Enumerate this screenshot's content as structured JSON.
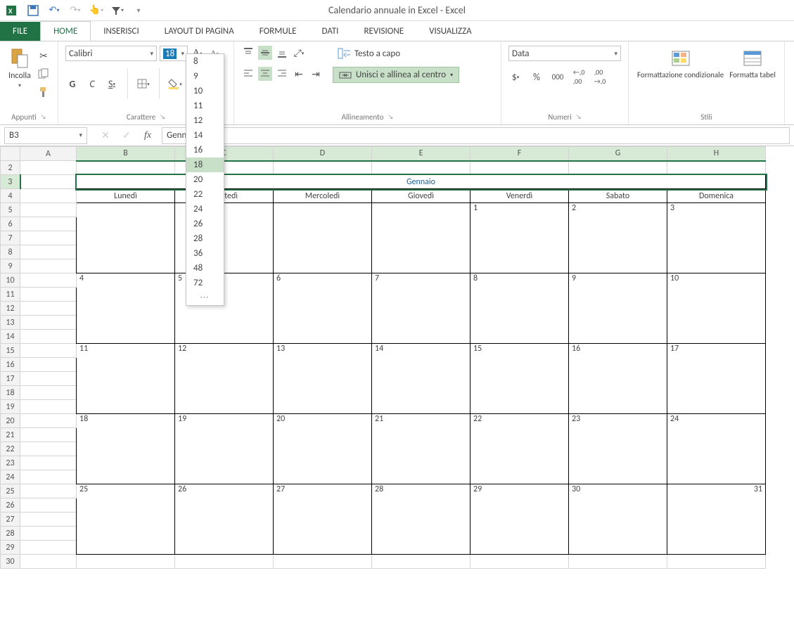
{
  "window_title": "Calendario annuale in Excel - Excel",
  "qat": {
    "undo_hint": "Undo",
    "redo_hint": "Redo"
  },
  "tabs": {
    "file": "FILE",
    "home": "HOME",
    "insert": "INSERISCI",
    "layout": "LAYOUT DI PAGINA",
    "formulas": "FORMULE",
    "data": "DATI",
    "review": "REVISIONE",
    "view": "VISUALIZZA"
  },
  "ribbon": {
    "clipboard": {
      "paste": "Incolla",
      "label": "Appunti"
    },
    "font": {
      "name": "Calibri",
      "size": "18",
      "label": "Carattere",
      "bold": "G",
      "italic": "C",
      "underline": "S",
      "sizes": [
        "8",
        "9",
        "10",
        "11",
        "12",
        "14",
        "16",
        "18",
        "20",
        "22",
        "24",
        "26",
        "28",
        "36",
        "48",
        "72"
      ]
    },
    "alignment": {
      "wrap": "Testo a capo",
      "merge": "Unisci e allinea al centro",
      "label": "Allineamento"
    },
    "number": {
      "format": "Data",
      "label": "Numeri"
    },
    "styles": {
      "condfmt": "Formattazione condizionale",
      "tablefmt": "Formatta tabel",
      "label": "Stili"
    }
  },
  "formula_bar": {
    "cell_ref": "B3",
    "formula": "Gennaio"
  },
  "columns": [
    "A",
    "B",
    "C",
    "D",
    "E",
    "F",
    "G",
    "H"
  ],
  "row_headers": [
    "2",
    "3",
    "4",
    "5",
    "6",
    "7",
    "8",
    "9",
    "10",
    "11",
    "12",
    "13",
    "14",
    "15",
    "16",
    "17",
    "18",
    "19",
    "20",
    "21",
    "22",
    "23",
    "24",
    "25",
    "26",
    "27",
    "28",
    "29",
    "30"
  ],
  "calendar": {
    "month": "Gennaio",
    "days": [
      "Lunedì",
      "Martedì",
      "Mercoledì",
      "Giovedì",
      "Venerdì",
      "Sabato",
      "Domenica"
    ],
    "weeks": [
      [
        "",
        "",
        "",
        "",
        "1",
        "2",
        "3"
      ],
      [
        "4",
        "5",
        "6",
        "7",
        "8",
        "9",
        "10"
      ],
      [
        "11",
        "12",
        "13",
        "14",
        "15",
        "16",
        "17"
      ],
      [
        "18",
        "19",
        "20",
        "21",
        "22",
        "23",
        "24"
      ],
      [
        "25",
        "26",
        "27",
        "28",
        "29",
        "30",
        "31"
      ]
    ]
  }
}
